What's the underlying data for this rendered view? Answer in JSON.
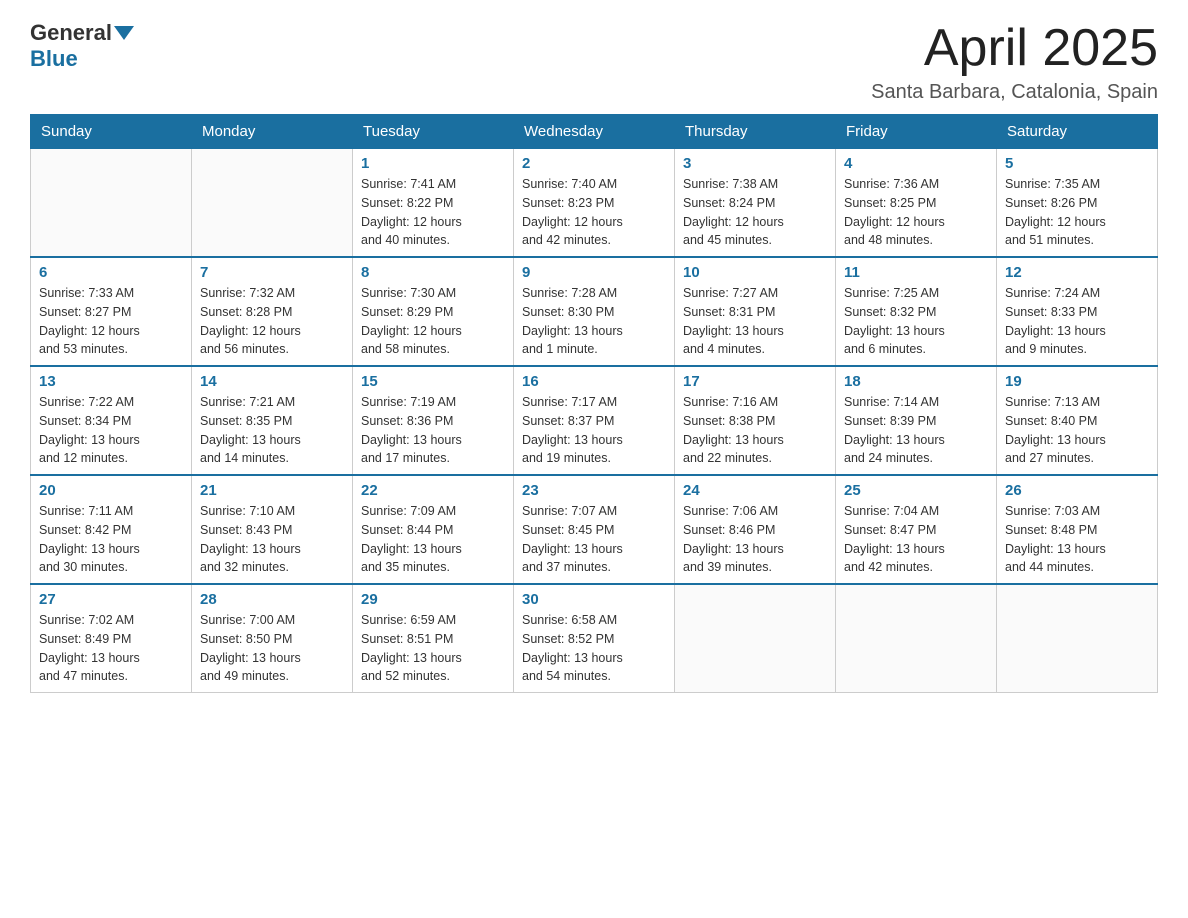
{
  "header": {
    "logo_general": "General",
    "logo_blue": "Blue",
    "month_title": "April 2025",
    "location": "Santa Barbara, Catalonia, Spain"
  },
  "days_of_week": [
    "Sunday",
    "Monday",
    "Tuesday",
    "Wednesday",
    "Thursday",
    "Friday",
    "Saturday"
  ],
  "weeks": [
    [
      {
        "day": "",
        "info": ""
      },
      {
        "day": "",
        "info": ""
      },
      {
        "day": "1",
        "info": "Sunrise: 7:41 AM\nSunset: 8:22 PM\nDaylight: 12 hours\nand 40 minutes."
      },
      {
        "day": "2",
        "info": "Sunrise: 7:40 AM\nSunset: 8:23 PM\nDaylight: 12 hours\nand 42 minutes."
      },
      {
        "day": "3",
        "info": "Sunrise: 7:38 AM\nSunset: 8:24 PM\nDaylight: 12 hours\nand 45 minutes."
      },
      {
        "day": "4",
        "info": "Sunrise: 7:36 AM\nSunset: 8:25 PM\nDaylight: 12 hours\nand 48 minutes."
      },
      {
        "day": "5",
        "info": "Sunrise: 7:35 AM\nSunset: 8:26 PM\nDaylight: 12 hours\nand 51 minutes."
      }
    ],
    [
      {
        "day": "6",
        "info": "Sunrise: 7:33 AM\nSunset: 8:27 PM\nDaylight: 12 hours\nand 53 minutes."
      },
      {
        "day": "7",
        "info": "Sunrise: 7:32 AM\nSunset: 8:28 PM\nDaylight: 12 hours\nand 56 minutes."
      },
      {
        "day": "8",
        "info": "Sunrise: 7:30 AM\nSunset: 8:29 PM\nDaylight: 12 hours\nand 58 minutes."
      },
      {
        "day": "9",
        "info": "Sunrise: 7:28 AM\nSunset: 8:30 PM\nDaylight: 13 hours\nand 1 minute."
      },
      {
        "day": "10",
        "info": "Sunrise: 7:27 AM\nSunset: 8:31 PM\nDaylight: 13 hours\nand 4 minutes."
      },
      {
        "day": "11",
        "info": "Sunrise: 7:25 AM\nSunset: 8:32 PM\nDaylight: 13 hours\nand 6 minutes."
      },
      {
        "day": "12",
        "info": "Sunrise: 7:24 AM\nSunset: 8:33 PM\nDaylight: 13 hours\nand 9 minutes."
      }
    ],
    [
      {
        "day": "13",
        "info": "Sunrise: 7:22 AM\nSunset: 8:34 PM\nDaylight: 13 hours\nand 12 minutes."
      },
      {
        "day": "14",
        "info": "Sunrise: 7:21 AM\nSunset: 8:35 PM\nDaylight: 13 hours\nand 14 minutes."
      },
      {
        "day": "15",
        "info": "Sunrise: 7:19 AM\nSunset: 8:36 PM\nDaylight: 13 hours\nand 17 minutes."
      },
      {
        "day": "16",
        "info": "Sunrise: 7:17 AM\nSunset: 8:37 PM\nDaylight: 13 hours\nand 19 minutes."
      },
      {
        "day": "17",
        "info": "Sunrise: 7:16 AM\nSunset: 8:38 PM\nDaylight: 13 hours\nand 22 minutes."
      },
      {
        "day": "18",
        "info": "Sunrise: 7:14 AM\nSunset: 8:39 PM\nDaylight: 13 hours\nand 24 minutes."
      },
      {
        "day": "19",
        "info": "Sunrise: 7:13 AM\nSunset: 8:40 PM\nDaylight: 13 hours\nand 27 minutes."
      }
    ],
    [
      {
        "day": "20",
        "info": "Sunrise: 7:11 AM\nSunset: 8:42 PM\nDaylight: 13 hours\nand 30 minutes."
      },
      {
        "day": "21",
        "info": "Sunrise: 7:10 AM\nSunset: 8:43 PM\nDaylight: 13 hours\nand 32 minutes."
      },
      {
        "day": "22",
        "info": "Sunrise: 7:09 AM\nSunset: 8:44 PM\nDaylight: 13 hours\nand 35 minutes."
      },
      {
        "day": "23",
        "info": "Sunrise: 7:07 AM\nSunset: 8:45 PM\nDaylight: 13 hours\nand 37 minutes."
      },
      {
        "day": "24",
        "info": "Sunrise: 7:06 AM\nSunset: 8:46 PM\nDaylight: 13 hours\nand 39 minutes."
      },
      {
        "day": "25",
        "info": "Sunrise: 7:04 AM\nSunset: 8:47 PM\nDaylight: 13 hours\nand 42 minutes."
      },
      {
        "day": "26",
        "info": "Sunrise: 7:03 AM\nSunset: 8:48 PM\nDaylight: 13 hours\nand 44 minutes."
      }
    ],
    [
      {
        "day": "27",
        "info": "Sunrise: 7:02 AM\nSunset: 8:49 PM\nDaylight: 13 hours\nand 47 minutes."
      },
      {
        "day": "28",
        "info": "Sunrise: 7:00 AM\nSunset: 8:50 PM\nDaylight: 13 hours\nand 49 minutes."
      },
      {
        "day": "29",
        "info": "Sunrise: 6:59 AM\nSunset: 8:51 PM\nDaylight: 13 hours\nand 52 minutes."
      },
      {
        "day": "30",
        "info": "Sunrise: 6:58 AM\nSunset: 8:52 PM\nDaylight: 13 hours\nand 54 minutes."
      },
      {
        "day": "",
        "info": ""
      },
      {
        "day": "",
        "info": ""
      },
      {
        "day": "",
        "info": ""
      }
    ]
  ]
}
